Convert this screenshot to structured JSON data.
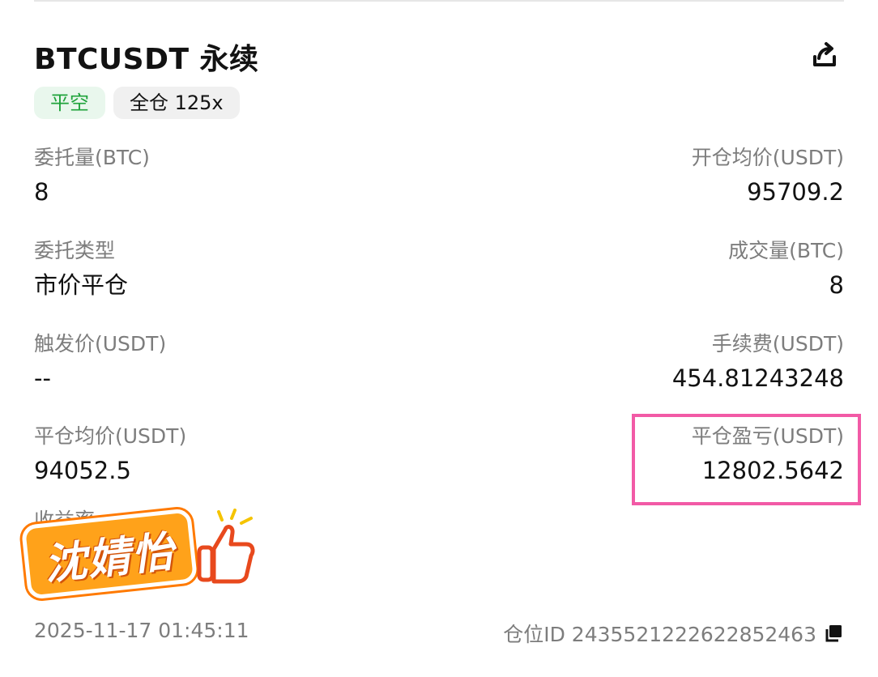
{
  "header": {
    "title": "BTCUSDT 永续",
    "share_icon": "share-icon"
  },
  "tags": {
    "side": "平空",
    "margin": "全仓 125x"
  },
  "fields": {
    "order_qty": {
      "label": "委托量(BTC)",
      "value": "8"
    },
    "open_avg_price": {
      "label": "开仓均价(USDT)",
      "value": "95709.2"
    },
    "order_type": {
      "label": "委托类型",
      "value": "市价平仓"
    },
    "filled_qty": {
      "label": "成交量(BTC)",
      "value": "8"
    },
    "trigger_price": {
      "label": "触发价(USDT)",
      "value": "--"
    },
    "fee": {
      "label": "手续费(USDT)",
      "value": "454.81243248"
    },
    "close_avg_price": {
      "label": "平仓均价(USDT)",
      "value": "94052.5"
    },
    "close_pnl": {
      "label": "平仓盈亏(USDT)",
      "value": "12802.5642"
    }
  },
  "partial_label": "收益率",
  "sticker": {
    "name": "沈婧怡",
    "icon": "thumbs-up-icon"
  },
  "footer": {
    "timestamp": "2025-11-17  01:45:11",
    "position_id": "仓位ID 2435521222622852463",
    "copy_icon": "copy-icon"
  },
  "colors": {
    "accent_green": "#1fa33b",
    "highlight_pink": "#f25aa6",
    "sticker_orange": "#ffa21a"
  }
}
